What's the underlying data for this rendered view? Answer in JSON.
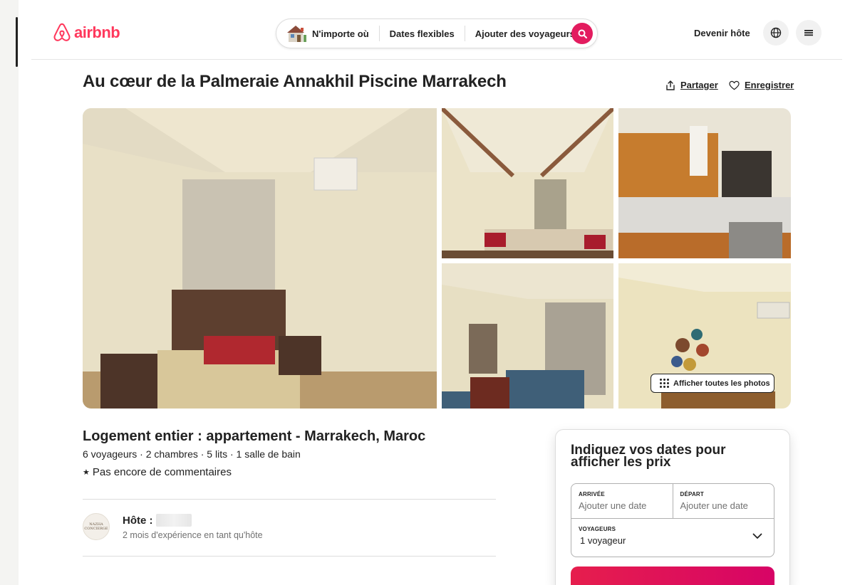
{
  "header": {
    "brand": "airbnb",
    "search": {
      "anywhere": "N'importe où",
      "dates": "Dates flexibles",
      "guests": "Ajouter des voyageurs"
    },
    "host_link": "Devenir hôte"
  },
  "listing": {
    "title": "Au cœur de la Palmeraie Annakhil Piscine Marrakech",
    "share": "Partager",
    "save": "Enregistrer",
    "show_all_photos": "Afficher toutes les photos",
    "type": "Logement entier : appartement - Marrakech, Maroc",
    "specs": "6 voyageurs · 2 chambres · 5 lits · 1 salle de bain",
    "reviews_star": "★",
    "reviews": "Pas encore de commentaires",
    "host_label": "Hôte :",
    "host_experience": "2 mois d'expérience en tant qu'hôte",
    "host_avatar_text": [
      "NAZHA",
      "CONCIERGE"
    ]
  },
  "booking": {
    "title": "Indiquez vos dates pour afficher les prix",
    "checkin_label": "ARRIVÉE",
    "checkin_value": "Ajouter une date",
    "checkout_label": "DÉPART",
    "checkout_value": "Ajouter une date",
    "guests_label": "VOYAGEURS",
    "guests_value": "1 voyageur"
  },
  "colors": {
    "brand": "#ff385c",
    "search_button": "#e31c5f",
    "text": "#222222",
    "muted": "#717171",
    "border": "#dddddd"
  }
}
